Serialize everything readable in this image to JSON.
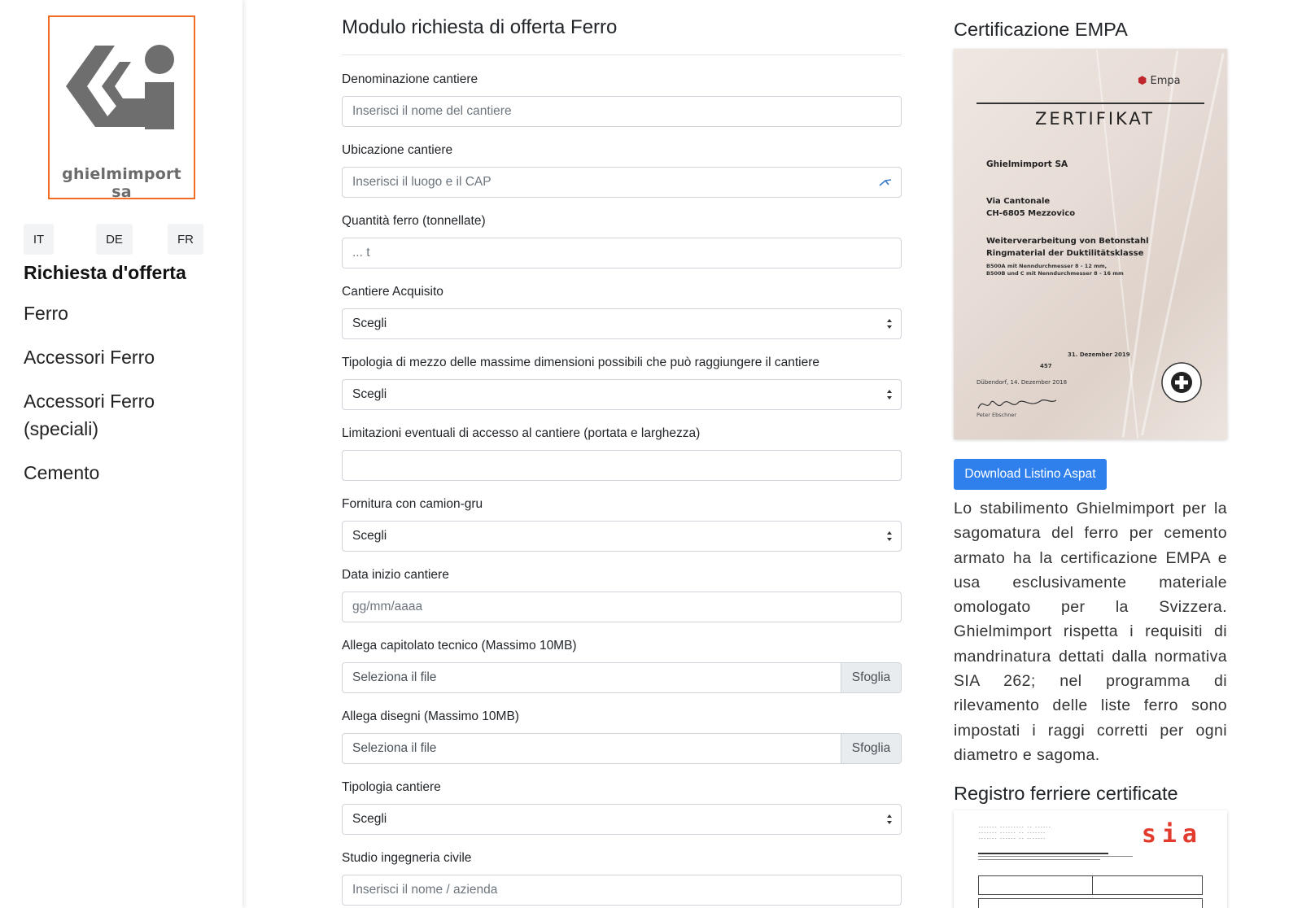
{
  "sidebar": {
    "logo_text": "ghielmimport sa",
    "languages": [
      "IT",
      "DE",
      "FR"
    ],
    "title": "Richiesta d'offerta",
    "nav": [
      "Ferro",
      "Accessori Ferro",
      "Accessori Ferro (speciali)",
      "Cemento"
    ]
  },
  "form": {
    "title": "Modulo richiesta di offerta Ferro",
    "fields": {
      "cantiere_name": {
        "label": "Denominazione cantiere",
        "placeholder": "Inserisci il nome del cantiere"
      },
      "cantiere_loc": {
        "label": "Ubicazione cantiere",
        "placeholder": "Inserisci il luogo e il CAP"
      },
      "quantita": {
        "label": "Quantità ferro (tonnellate)",
        "placeholder": "... t"
      },
      "acquisito": {
        "label": "Cantiere Acquisito",
        "value": "Scegli"
      },
      "mezzo": {
        "label": "Tipologia di mezzo delle massime dimensioni possibili che può raggiungere il cantiere",
        "value": "Scegli"
      },
      "limitazioni": {
        "label": "Limitazioni eventuali di accesso al cantiere (portata e larghezza)",
        "value": ""
      },
      "camion_gru": {
        "label": "Fornitura con camion-gru",
        "value": "Scegli"
      },
      "data_inizio": {
        "label": "Data inizio cantiere",
        "placeholder": "gg/mm/aaaa"
      },
      "capitolato": {
        "label": "Allega capitolato tecnico (Massimo 10MB)",
        "value": "Seleziona il file",
        "browse": "Sfoglia"
      },
      "disegni": {
        "label": "Allega disegni (Massimo 10MB)",
        "value": "Seleziona il file",
        "browse": "Sfoglia"
      },
      "tipologia": {
        "label": "Tipologia cantiere",
        "value": "Scegli"
      },
      "studio": {
        "label": "Studio ingegneria civile",
        "placeholder": "Inserisci il nome / azienda"
      }
    }
  },
  "right": {
    "cert_title": "Certificazione EMPA",
    "certificate": {
      "brand": "Empa",
      "heading": "ZERTIFIKAT",
      "company": "Ghielmimport SA",
      "street": "Via Cantonale",
      "city": "CH-6805 Mezzovico",
      "scope_1": "Weiterverarbeitung von Betonstahl",
      "scope_2": "Ringmaterial der Duktilitätsklasse",
      "spec_1": "B500A mit Nenndurchmesser 8 - 12 mm,",
      "spec_2": "B500B und C mit Nenndurchmesser 8 - 16 mm",
      "valid": "31. Dezember 2019",
      "reg_nr": "457",
      "place_date": "Dübendorf, 14. Dezember 2018",
      "signer": "Peter Ebschner"
    },
    "download_label": "Download Listino Aspat",
    "description": "Lo stabilimento Ghielmimport per la sagomatura del ferro per cemento armato ha la certificazione EMPA e usa esclusivamente materiale omologato per la Svizzera. Ghielmimport rispetta i requisiti di mandrinatura dettati dalla normativa SIA 262; nel programma di rilevamento delle liste ferro sono impostati i raggi corretti per ogni diametro e sagoma.",
    "registry_title": "Registro ferriere certificate",
    "sia_logo": "sia"
  },
  "colors": {
    "accent_orange": "#f26c22",
    "button_blue": "#2f80ed",
    "sia_red": "#e23b2e"
  }
}
